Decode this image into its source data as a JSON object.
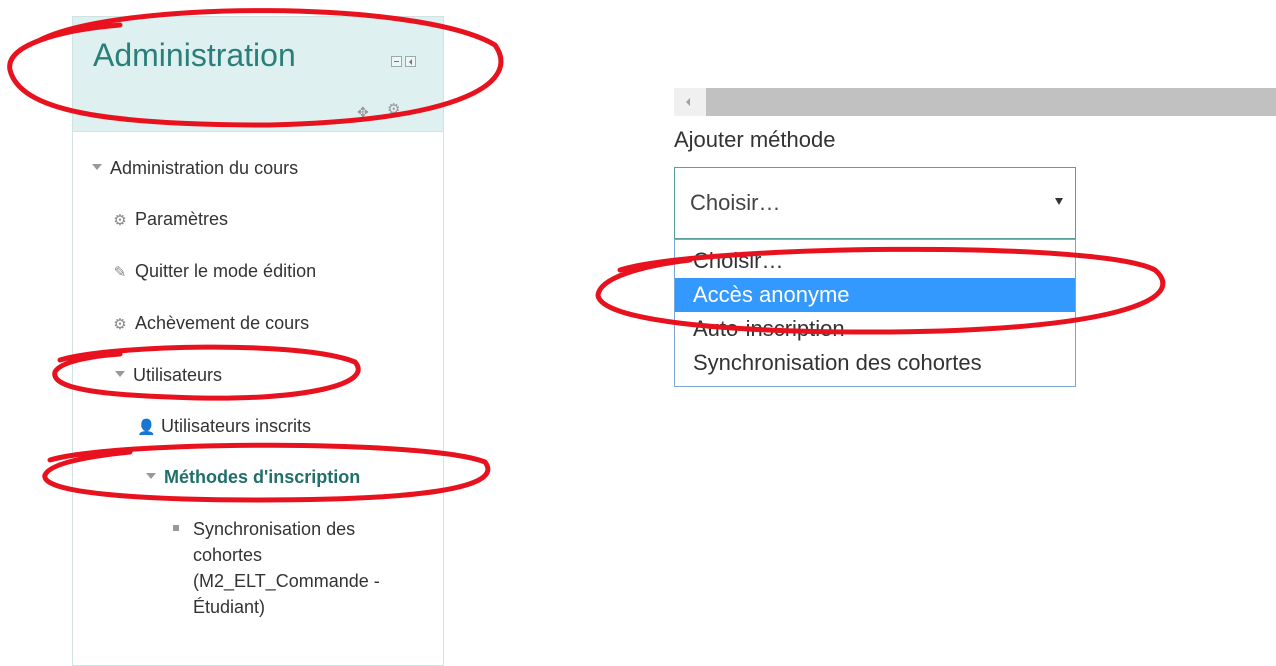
{
  "admin": {
    "title": "Administration",
    "items": [
      {
        "label": "Administration du cours",
        "icon": "caret-down-icon"
      },
      {
        "label": "Paramètres",
        "icon": "gear-icon"
      },
      {
        "label": "Quitter le mode édition",
        "icon": "pencil-icon"
      },
      {
        "label": "Achèvement de cours",
        "icon": "gear-icon"
      },
      {
        "label": "Utilisateurs",
        "icon": "caret-down-icon"
      },
      {
        "label": "Utilisateurs inscrits",
        "icon": "user-icon"
      },
      {
        "label": "Méthodes d'inscription",
        "icon": "caret-down-icon"
      },
      {
        "label_lines": [
          "Synchronisation des",
          "cohortes",
          "(M2_ELT_Commande -",
          "Étudiant)"
        ],
        "icon": "bullet-icon"
      }
    ]
  },
  "form": {
    "label": "Ajouter méthode",
    "select_value": "Choisir…",
    "options": [
      "Choisir…",
      "Accès anonyme",
      "Auto-inscription",
      "Synchronisation des cohortes"
    ],
    "selected_option": "Accès anonyme"
  },
  "colors": {
    "annotation": "#e8121e",
    "accent": "#2b7f7a",
    "selection": "#3399ff",
    "header_bg": "#def0f0"
  }
}
